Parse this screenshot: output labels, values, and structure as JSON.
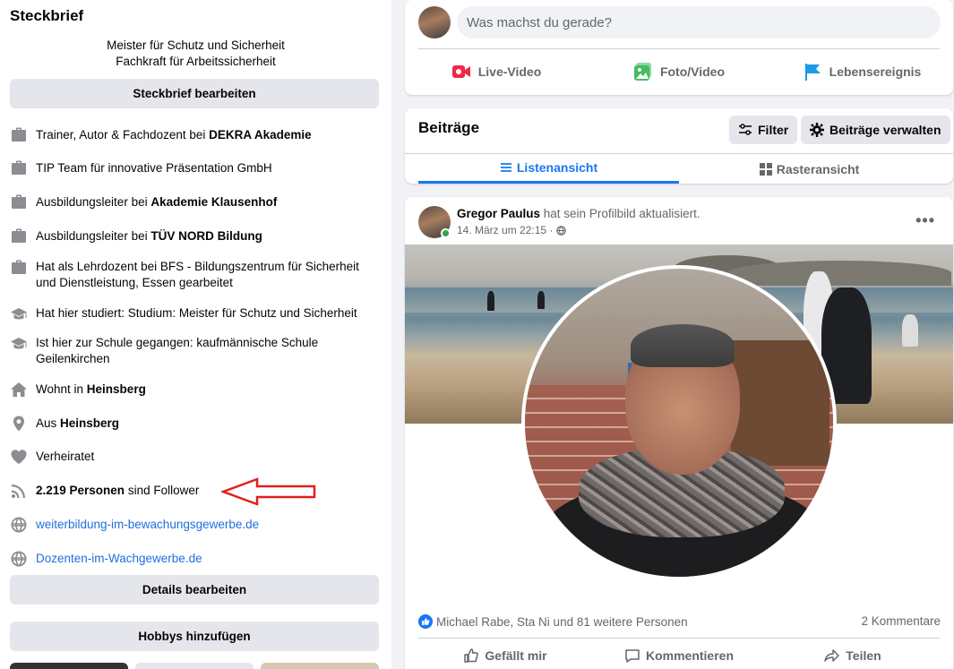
{
  "intro": {
    "title": "Steckbrief",
    "bio_line1": "Meister für Schutz und Sicherheit",
    "bio_line2": "Fachkraft für Arbeitssicherheit",
    "edit_bio_button": "Steckbrief bearbeiten",
    "items": [
      {
        "icon": "briefcase-icon",
        "pre": "Trainer, Autor & Fachdozent bei ",
        "bold": "DEKRA Akademie",
        "post": ""
      },
      {
        "icon": "briefcase-icon",
        "pre": "TIP Team für innovative Präsentation GmbH",
        "bold": "",
        "post": ""
      },
      {
        "icon": "briefcase-icon",
        "pre": "Ausbildungsleiter bei ",
        "bold": "Akademie Klausenhof",
        "post": ""
      },
      {
        "icon": "briefcase-icon",
        "pre": "Ausbildungsleiter bei ",
        "bold": "TÜV NORD Bildung",
        "post": ""
      },
      {
        "icon": "briefcase-icon",
        "pre": "Hat als Lehrdozent bei BFS - Bildungszentrum für Sicherheit und Dienstleistung, Essen gearbeitet",
        "bold": "",
        "post": ""
      },
      {
        "icon": "graduation-cap-icon",
        "pre": "Hat hier studiert: Studium: Meister für Schutz und Sicherheit",
        "bold": "",
        "post": ""
      },
      {
        "icon": "graduation-cap-icon",
        "pre": "Ist hier zur Schule gegangen: kaufmännische Schule Geilenkirchen",
        "bold": "",
        "post": ""
      },
      {
        "icon": "home-icon",
        "pre": "Wohnt in ",
        "bold": "Heinsberg",
        "post": ""
      },
      {
        "icon": "location-pin-icon",
        "pre": "Aus ",
        "bold": "Heinsberg",
        "post": ""
      },
      {
        "icon": "heart-icon",
        "pre": "Verheiratet",
        "bold": "",
        "post": ""
      },
      {
        "icon": "rss-icon",
        "pre": "",
        "bold": "2.219 Personen",
        "post": " sind Follower"
      }
    ],
    "links": [
      {
        "icon": "globe-icon",
        "text": "weiterbildung-im-bewachungsgewerbe.de"
      },
      {
        "icon": "globe-icon",
        "text": "Dozenten-im-Wachgewerbe.de"
      }
    ],
    "edit_details_button": "Details bearbeiten",
    "add_hobbies_button": "Hobbys hinzufügen"
  },
  "composer": {
    "placeholder": "Was machst du gerade?",
    "live_video": "Live-Video",
    "photo_video": "Foto/Video",
    "life_event": "Lebensereignis"
  },
  "posts_header": {
    "title": "Beiträge",
    "filter_button": "Filter",
    "manage_button": "Beiträge verwalten",
    "tab_list": "Listenansicht",
    "tab_grid": "Rasteransicht"
  },
  "post": {
    "author": "Gregor Paulus",
    "action": " hat sein Profilbild aktualisiert.",
    "timestamp": "14. März um 22:15 · ",
    "more": "•••",
    "likes": "Michael Rabe, Sta Ni und 81 weitere Personen",
    "comments": "2 Kommentare",
    "like_button": "Gefällt mir",
    "comment_button": "Kommentieren",
    "share_button": "Teilen"
  },
  "colors": {
    "accent": "#1877f2",
    "link": "#216fdb",
    "annotation_arrow": "#e0201b",
    "live_video_icon": "#f02849",
    "photo_icon": "#45bd62",
    "flag_icon": "#1b9ae8"
  }
}
